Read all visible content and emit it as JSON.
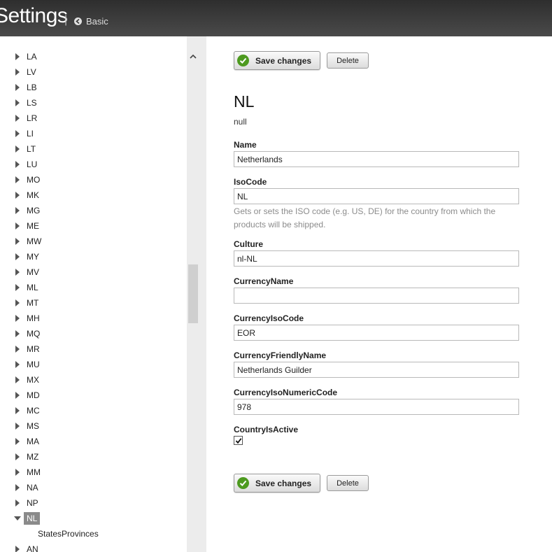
{
  "header": {
    "title": "Settings",
    "separator": "|",
    "basic_link": "Basic"
  },
  "tree": {
    "items": [
      {
        "label": "LA"
      },
      {
        "label": "LV"
      },
      {
        "label": "LB"
      },
      {
        "label": "LS"
      },
      {
        "label": "LR"
      },
      {
        "label": "LI"
      },
      {
        "label": "LT"
      },
      {
        "label": "LU"
      },
      {
        "label": "MO"
      },
      {
        "label": "MK"
      },
      {
        "label": "MG"
      },
      {
        "label": "ME"
      },
      {
        "label": "MW"
      },
      {
        "label": "MY"
      },
      {
        "label": "MV"
      },
      {
        "label": "ML"
      },
      {
        "label": "MT"
      },
      {
        "label": "MH"
      },
      {
        "label": "MQ"
      },
      {
        "label": "MR"
      },
      {
        "label": "MU"
      },
      {
        "label": "MX"
      },
      {
        "label": "MD"
      },
      {
        "label": "MC"
      },
      {
        "label": "MS"
      },
      {
        "label": "MA"
      },
      {
        "label": "MZ"
      },
      {
        "label": "MM"
      },
      {
        "label": "NA"
      },
      {
        "label": "NP"
      },
      {
        "label": "NL"
      }
    ],
    "selected_child": "StatesProvinces",
    "next_item": "AN"
  },
  "toolbar": {
    "save_label": "Save changes",
    "delete_label": "Delete"
  },
  "entity": {
    "title": "NL",
    "subtitle": "null"
  },
  "fields": {
    "name": {
      "label": "Name",
      "value": "Netherlands"
    },
    "iso_code": {
      "label": "IsoCode",
      "value": "NL",
      "help": "Gets or sets the ISO code (e.g. US, DE) for the country from which the products will be shipped."
    },
    "culture": {
      "label": "Culture",
      "value": "nl-NL"
    },
    "currency_name": {
      "label": "CurrencyName",
      "value": ""
    },
    "currency_iso_code": {
      "label": "CurrencyIsoCode",
      "value": "EOR"
    },
    "currency_friendly_name": {
      "label": "CurrencyFriendlyName",
      "value": "Netherlands Guilder"
    },
    "currency_iso_numeric_code": {
      "label": "CurrencyIsoNumericCode",
      "value": "978"
    },
    "country_is_active": {
      "label": "CountryIsActive",
      "checked": true
    }
  },
  "colors": {
    "header_bg": "#3a3a3a",
    "save_icon": "#4d9a1f",
    "selected_item_bg": "#8a8a8a"
  }
}
